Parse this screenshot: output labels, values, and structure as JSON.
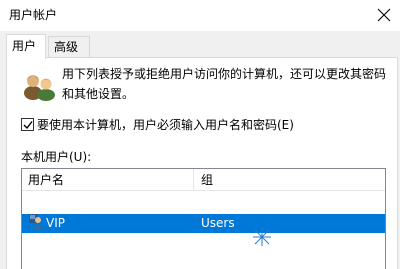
{
  "window": {
    "title": "用户帐户"
  },
  "tabs": [
    {
      "label": "用户",
      "active": true
    },
    {
      "label": "高级",
      "active": false
    }
  ],
  "intro_text": "用下列表授予或拒绝用户访问你的计算机，还可以更改其密码和其他设置。",
  "require_login": {
    "label": "要使用本计算机，用户必须输入用户名和密码(E)",
    "checked": true
  },
  "local_users_label": "本机用户(U):",
  "list": {
    "columns": [
      "用户名",
      "组"
    ],
    "rows": [
      {
        "username": "VIP",
        "group": "Users",
        "selected": true
      }
    ]
  },
  "colors": {
    "selection": "#0078d7",
    "dialog_bg": "#f0f0f0",
    "panel_bg": "#ffffff"
  },
  "icons": {
    "close": "close-icon",
    "users": "users-group-icon",
    "user_row": "user-account-icon",
    "check": "checkmark-icon"
  }
}
